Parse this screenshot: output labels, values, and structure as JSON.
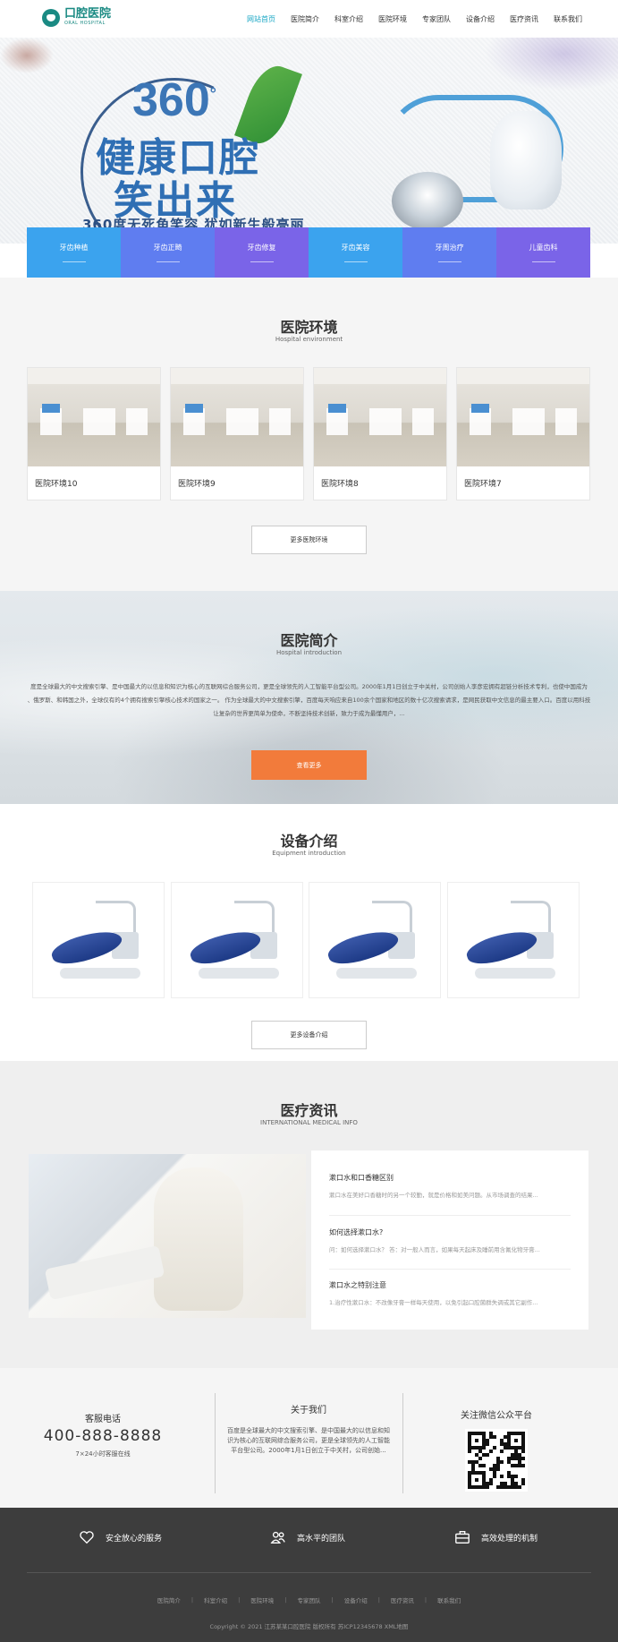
{
  "colors": {
    "brand": "#1a8a83",
    "nav_active": "#1aa7c5",
    "orange_button": "#f27b3b",
    "footer_bg": "#3d3d3d"
  },
  "header": {
    "logo_cn": "口腔医院",
    "logo_en": "ORAL HOSPITAL",
    "nav": [
      {
        "label": "网站首页",
        "active": true
      },
      {
        "label": "医院简介"
      },
      {
        "label": "科室介绍"
      },
      {
        "label": "医院环境"
      },
      {
        "label": "专家团队"
      },
      {
        "label": "设备介绍"
      },
      {
        "label": "医疗资讯"
      },
      {
        "label": "联系我们"
      }
    ]
  },
  "banner": {
    "number": "360",
    "degree": "°",
    "line1": "健康口腔",
    "line2": "笑出来",
    "subtitle": "360度无死角笑容 犹如新生般亮丽"
  },
  "services": [
    {
      "label": "牙齿种植",
      "color": "#3ba3ee"
    },
    {
      "label": "牙齿正畸",
      "color": "#5f7df0"
    },
    {
      "label": "牙齿修复",
      "color": "#7a64e8"
    },
    {
      "label": "牙齿美容",
      "color": "#3ba3ee"
    },
    {
      "label": "牙周治疗",
      "color": "#5f7df0"
    },
    {
      "label": "儿童齿科",
      "color": "#7a64e8"
    }
  ],
  "environment": {
    "title": "医院环境",
    "subtitle": "Hospital environment",
    "items": [
      "医院环境10",
      "医院环境9",
      "医院环境8",
      "医院环境7"
    ],
    "more": "更多医院环境"
  },
  "intro": {
    "title": "医院简介",
    "subtitle": "Hospital introduction",
    "lines": [
      "度是全球最大的中文搜索引擎、是中国最大的以信息和知识为核心的互联网综合服务公司，更是全球领先的人工智能平台型公司。2000年1月1日创立于中关村，公司创始人李彦宏拥有超链分析技术专利，也使中国成为",
      "、俄罗斯、和韩国之外，全球仅有的4个拥有搜索引擎核心技术的国家之一。  作为全球最大的中文搜索引擎，百度每天响应来自100余个国家和地区的数十亿次搜索请求，是网民获取中文信息的最主要入口。百度以用科技",
      "让复杂的世界更简单为使命，不断坚持技术创新，致力于成为最懂用户，..."
    ],
    "button": "查看更多"
  },
  "equipment": {
    "title": "设备介绍",
    "subtitle": "Equipment introduction",
    "count": 4,
    "more": "更多设备介绍"
  },
  "news": {
    "title": "医疗资讯",
    "subtitle": "INTERNATIONAL MEDICAL INFO",
    "items": [
      {
        "title": "漱口水和口香糖区别",
        "desc": "漱口水在美好口香糖时的另一个较勤，就是价格和如美问题。从市场调查的结果..."
      },
      {
        "title": "如何选择漱口水?",
        "desc": "问：如何选择漱口水？  答：对一般人而言，如果每天起床及睡前用含氟化物牙膏..."
      },
      {
        "title": "漱口水之特别注意",
        "desc": "1.治疗性漱口水：不改像牙膏一样每天使用，以免引起口腔菌群失调或其它副作..."
      }
    ]
  },
  "contact": {
    "service_title": "客服电话",
    "phone": "400-888-8888",
    "hours": "7×24小时客服在线",
    "about_title": "关于我们",
    "about_text": "百度是全球最大的中文搜索引擎、是中国最大的以信息和知识为核心的互联网综合服务公司，更是全球领先的人工智能平台型公司。2000年1月1日创立于中关村，公司创始...",
    "wechat_title": "关注微信公众平台"
  },
  "footer": {
    "features": [
      {
        "label": "安全放心的服务",
        "icon": "heart-icon"
      },
      {
        "label": "高水平的团队",
        "icon": "team-icon"
      },
      {
        "label": "高效处理的机制",
        "icon": "briefcase-icon"
      }
    ],
    "links": [
      "医院简介",
      "科室介绍",
      "医院环境",
      "专家团队",
      "设备介绍",
      "医疗资讯",
      "联系我们"
    ],
    "copyright": "Copyright © 2021 江苏某某口腔医院 版权所有",
    "icp": "苏ICP12345678",
    "xml": "XML地图"
  }
}
